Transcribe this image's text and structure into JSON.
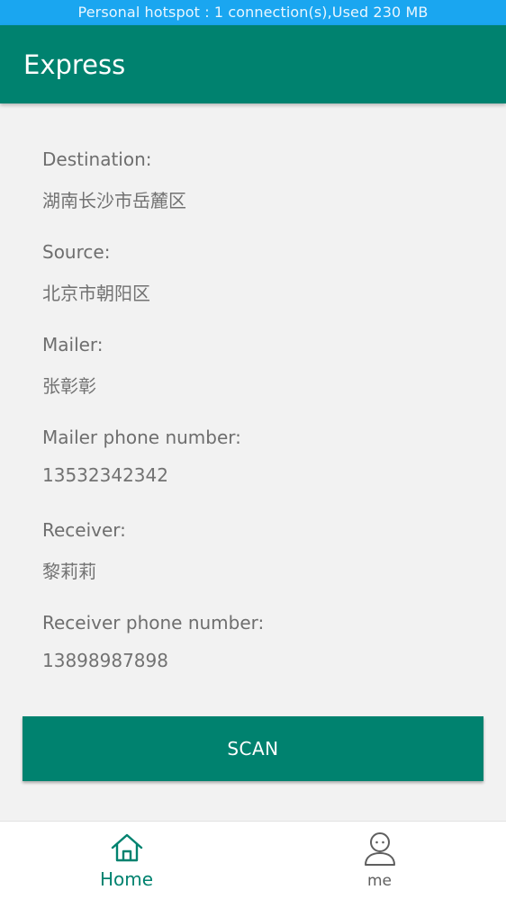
{
  "status_bar": {
    "text": "Personal hotspot : 1 connection(s),Used  230 MB"
  },
  "app_bar": {
    "title": "Express"
  },
  "details": {
    "destination_label": "Destination:",
    "destination_value": "湖南长沙市岳麓区",
    "source_label": "Source:",
    "source_value": "北京市朝阳区",
    "mailer_label": "Mailer:",
    "mailer_value": "张彰彰",
    "mailer_phone_label": "Mailer phone number:",
    "mailer_phone_value": "13532342342",
    "receiver_label": "Receiver:",
    "receiver_value": "黎莉莉",
    "receiver_phone_label": "Receiver phone number:",
    "receiver_phone_value": "13898987898"
  },
  "actions": {
    "scan_label": "SCAN"
  },
  "bottom_nav": {
    "items": [
      {
        "label": "Home",
        "icon": "home-icon",
        "active": true
      },
      {
        "label": "me",
        "icon": "person-icon",
        "active": false
      }
    ]
  },
  "colors": {
    "primary": "#00826f",
    "status_bar": "#1aa6f0",
    "background": "#f2f2f2",
    "text_secondary": "#6e6e6e"
  }
}
